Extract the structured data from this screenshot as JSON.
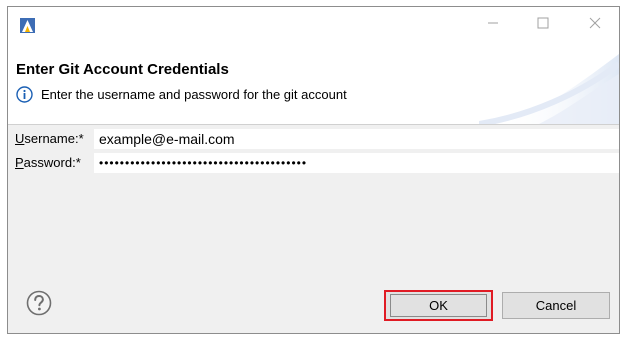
{
  "window": {
    "controls": {
      "minimize": "—",
      "maximize": "☐",
      "close": "✕"
    }
  },
  "header": {
    "title": "Enter Git Account Credentials",
    "message": "Enter the username and password for the git account"
  },
  "form": {
    "username": {
      "label_mnemonic": "U",
      "label_rest": "sername:*",
      "value": "example@e-mail.com"
    },
    "password": {
      "label_mnemonic": "P",
      "label_rest": "assword:*",
      "value": "••••••••••••••••••••••••••••••••••••••••"
    }
  },
  "buttons": {
    "ok": "OK",
    "cancel": "Cancel"
  },
  "colors": {
    "highlight": "#e01b24",
    "info_blue": "#1a5fb4"
  }
}
